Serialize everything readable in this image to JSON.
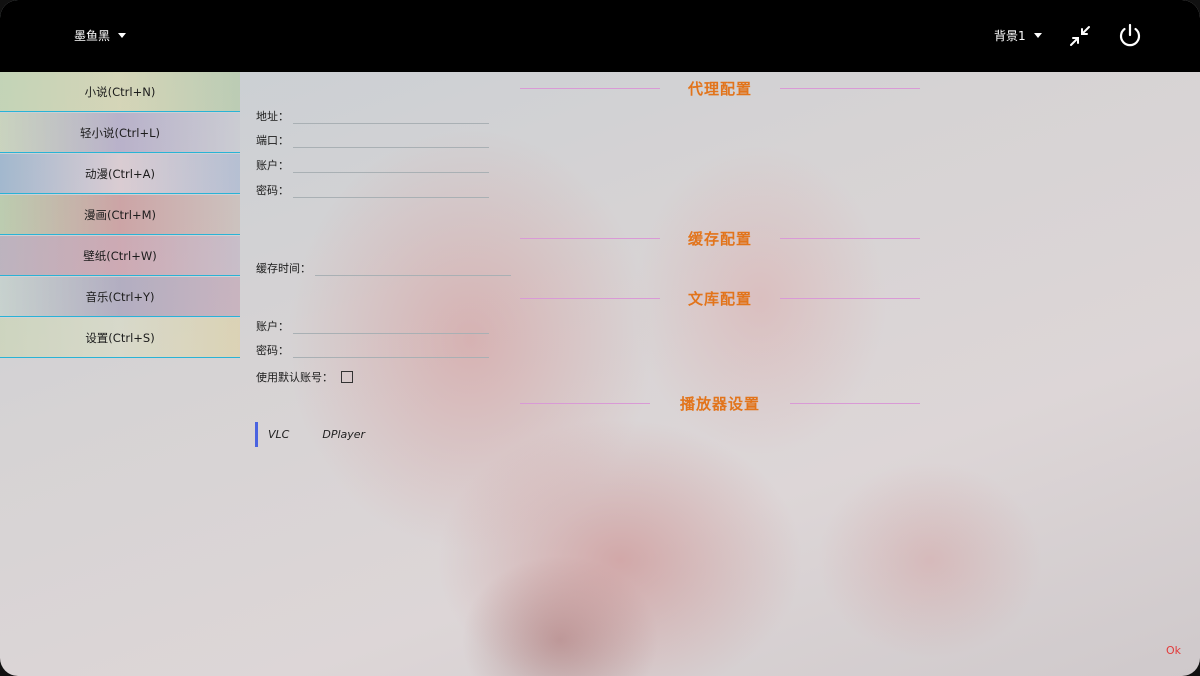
{
  "header": {
    "user_label": "墨鱼黑",
    "background_label": "背景1"
  },
  "sidebar": {
    "items": [
      {
        "label": "小说(Ctrl+N)"
      },
      {
        "label": "轻小说(Ctrl+L)"
      },
      {
        "label": "动漫(Ctrl+A)"
      },
      {
        "label": "漫画(Ctrl+M)"
      },
      {
        "label": "壁纸(Ctrl+W)"
      },
      {
        "label": "音乐(Ctrl+Y)"
      },
      {
        "label": "设置(Ctrl+S)"
      }
    ]
  },
  "proxy": {
    "title": "代理配置",
    "address_label": "地址：",
    "port_label": "端口：",
    "account_label": "账户：",
    "password_label": "密码："
  },
  "cache": {
    "title": "缓存配置",
    "time_label": "缓存时间："
  },
  "library": {
    "title": "文库配置",
    "account_label": "账户：",
    "password_label": "密码：",
    "default_account_label": "使用默认账号："
  },
  "player": {
    "title": "播放器设置",
    "options": [
      "VLC",
      "DPlayer"
    ]
  },
  "footer": {
    "ok_label": "Ok"
  }
}
